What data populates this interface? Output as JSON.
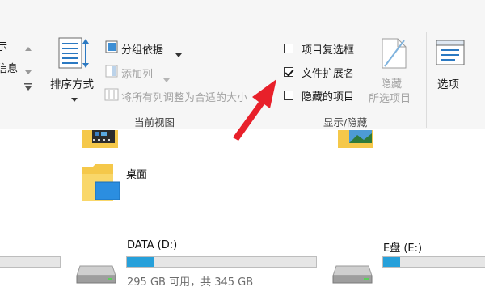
{
  "ribbon": {
    "left_group": {
      "line1": "示",
      "line2": "信息"
    },
    "sort_label": "排序方式",
    "group_by_label": "分组依据",
    "add_columns_label": "添加列",
    "fit_columns_label": "将所有列调整为合适的大小",
    "current_view_group": "当前视图",
    "item_checkboxes_label": "项目复选框",
    "file_extensions_label": "文件扩展名",
    "hidden_items_label": "隐藏的项目",
    "hide_selected_line1": "隐藏",
    "hide_selected_line2": "所选项目",
    "show_hide_group": "显示/隐藏",
    "options_label": "选项",
    "checkboxes": {
      "item_checkboxes": false,
      "file_extensions": true,
      "hidden_items": false
    }
  },
  "files": {
    "desktop_label": "桌面"
  },
  "drives": [
    {
      "name": "",
      "free_text": "",
      "used_fraction": 0.0
    },
    {
      "name": "DATA (D:)",
      "free_text": "295 GB 可用，共 345 GB",
      "used_fraction": 0.145
    },
    {
      "name": "E盘 (E:)",
      "free_text": "",
      "used_fraction": 0.15
    }
  ],
  "colors": {
    "accent": "#26a0da",
    "arrow": "#e8202a",
    "folder": "#f5c84a"
  }
}
